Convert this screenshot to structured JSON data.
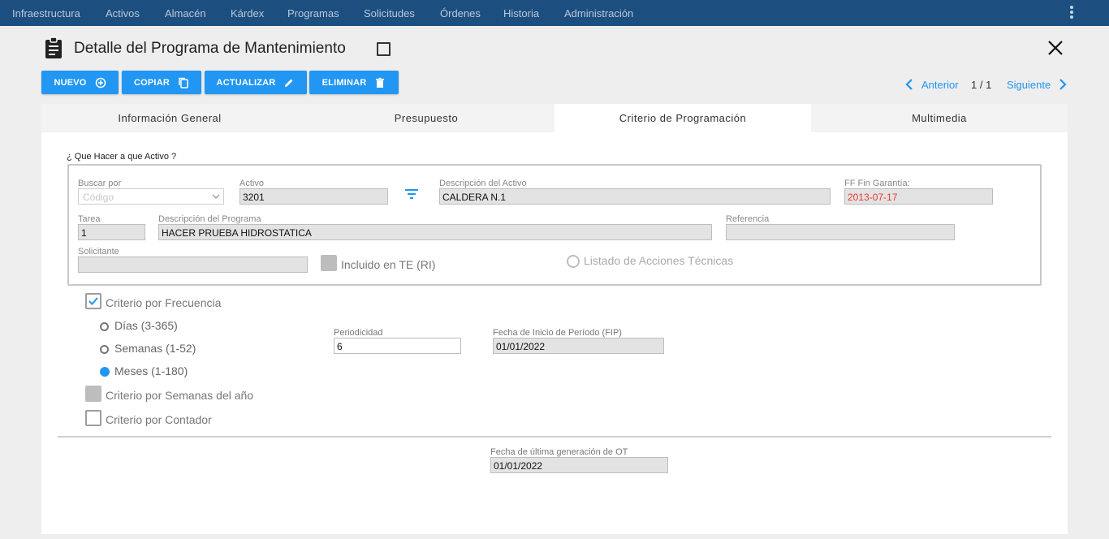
{
  "nav": {
    "items": [
      "Infraestructura",
      "Activos",
      "Almacén",
      "Kárdex",
      "Programas",
      "Solicitudes",
      "Órdenes",
      "Historia",
      "Administración"
    ],
    "menu_icon": "more-vert-icon"
  },
  "header": {
    "title": "Detalle del Programa de Mantenimiento",
    "icon": "clipboard-icon",
    "close_icon": "close-icon"
  },
  "toolbar": {
    "new_label": "NUEVO",
    "copy_label": "COPIAR",
    "update_label": "ACTUALIZAR",
    "delete_label": "ELIMINAR"
  },
  "pager": {
    "prev_label": "Anterior",
    "count": "1 / 1",
    "next_label": "Siguiente"
  },
  "tabs": [
    "Información General",
    "Presupuesto",
    "Criterio de Programación",
    "Multimedia"
  ],
  "active_tab": 2,
  "form": {
    "section_label": "¿ Que Hacer a que Activo ?",
    "buscar_por_label": "Buscar por",
    "buscar_por_value": "Código",
    "activo_label": "Activo",
    "activo_value": "3201",
    "descripcion_activo_label": "Descripción del Activo",
    "descripcion_activo_value": "CALDERA N.1",
    "ff_fin_garantia_label": "FF Fin Garantía:",
    "ff_fin_garantia_value": "2013-07-17",
    "tarea_label": "Tarea",
    "tarea_value": "1",
    "descripcion_programa_label": "Descripción del Programa",
    "descripcion_programa_value": "HACER PRUEBA HIDROSTATICA",
    "referencia_label": "Referencia",
    "referencia_value": "",
    "solicitante_label": "Solicitante",
    "solicitante_value": "",
    "incluido_label": "Incluido en TE (RI)",
    "listado_label": "Listado de Acciones Técnicas"
  },
  "criteria": {
    "frecuencia_label": "Criterio por Frecuencia",
    "frecuencia_checked": true,
    "dias_label": "Días (3-365)",
    "semanas_label": "Semanas (1-52)",
    "meses_label": "Meses (1-180)",
    "selected_period": "Meses (1-180)",
    "periodicidad_label": "Periodicidad",
    "periodicidad_value": "6",
    "fip_label": "Fecha de Inicio de Período (FIP)",
    "fip_value": "01/01/2022",
    "semanas_anio_label": "Criterio por Semanas del año",
    "contador_label": "Criterio por Contador",
    "ultima_gen_label": "Fecha de última generación de OT",
    "ultima_gen_value": "01/01/2022"
  },
  "colors": {
    "nav_bg": "#1c4f80",
    "accent": "#2196f3",
    "danger_text": "#e53935"
  }
}
